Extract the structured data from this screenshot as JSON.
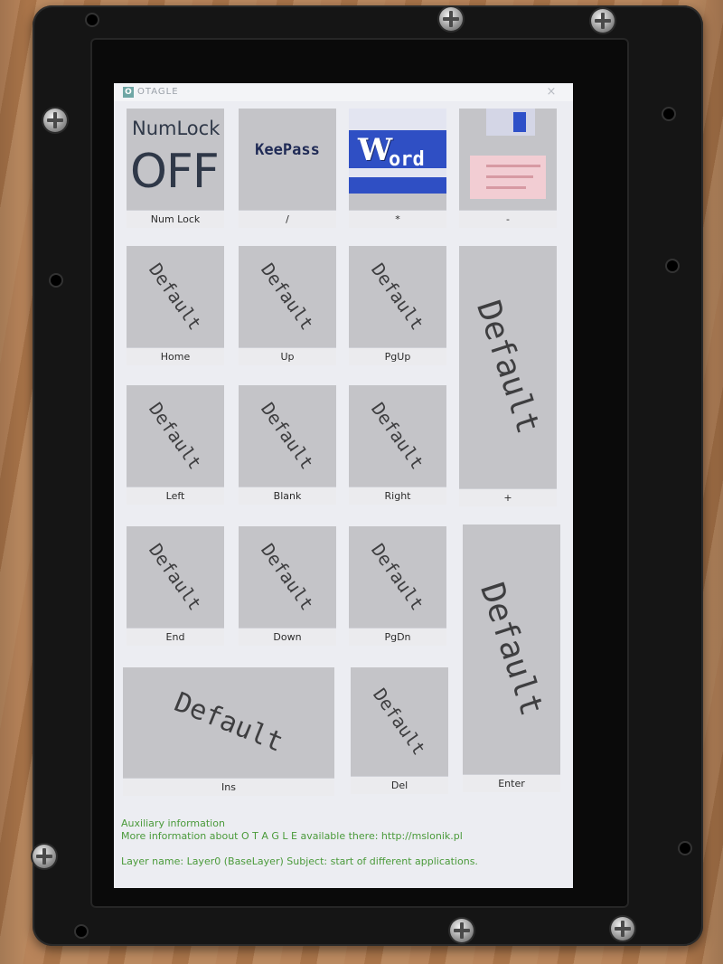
{
  "window": {
    "logo": "O",
    "title": "OTAGLE",
    "close": "×"
  },
  "tiles": {
    "numlock": {
      "line1": "NumLock",
      "line2": "OFF",
      "label": "Num Lock"
    },
    "keepass": {
      "text": "KeePass",
      "label": "/"
    },
    "word": {
      "w": "W",
      "rest": "ord",
      "label": "*"
    },
    "save": {
      "label": "-"
    },
    "home": {
      "text": "Default",
      "label": "Home"
    },
    "up": {
      "text": "Default",
      "label": "Up"
    },
    "pgup": {
      "text": "Default",
      "label": "PgUp"
    },
    "plus": {
      "text": "Default",
      "label": "+"
    },
    "left": {
      "text": "Default",
      "label": "Left"
    },
    "blank": {
      "text": "Default",
      "label": "Blank"
    },
    "right": {
      "text": "Default",
      "label": "Right"
    },
    "end": {
      "text": "Default",
      "label": "End"
    },
    "down": {
      "text": "Default",
      "label": "Down"
    },
    "pgdn": {
      "text": "Default",
      "label": "PgDn"
    },
    "enter": {
      "text": "Default",
      "label": "Enter"
    },
    "ins": {
      "text": "Default",
      "label": "Ins"
    },
    "del": {
      "text": "Default",
      "label": "Del"
    }
  },
  "footer": {
    "heading": "Auxiliary information",
    "info": "More information about O T A G L E available there: http://mslonik.pl",
    "layer": "Layer name: Layer0 (BaseLayer)  Subject: start of different applications."
  },
  "colors": {
    "footer_text": "#4a9a3a",
    "keepass_bg": "#8a9be2",
    "word_blue": "#2f4fc4",
    "save_blue": "#2e50c8"
  },
  "icons": [
    "otagle-logo-icon",
    "close-icon",
    "floppy-disk-icon"
  ]
}
